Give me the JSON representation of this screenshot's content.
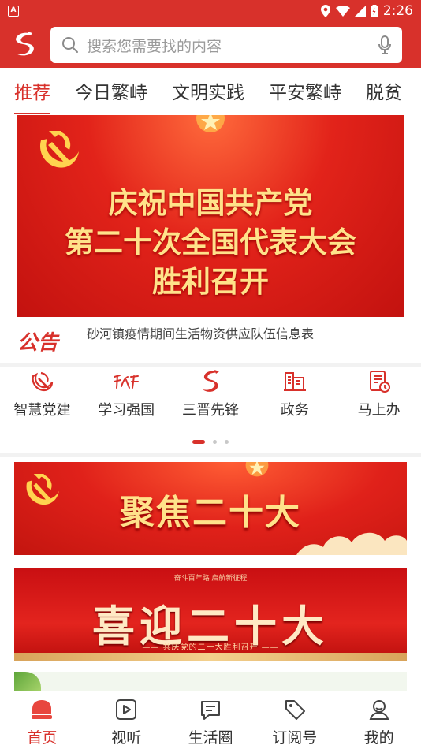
{
  "status_bar": {
    "time": "2:26",
    "app_badge": "A"
  },
  "search": {
    "placeholder": "搜索您需要找的内容"
  },
  "tabs": [
    {
      "label": "推荐",
      "active": true
    },
    {
      "label": "今日繁峙"
    },
    {
      "label": "文明实践"
    },
    {
      "label": "平安繁峙"
    },
    {
      "label": "脱贫"
    }
  ],
  "banner": {
    "line1": "庆祝中国共产党",
    "line2": "第二十次全国代表大会",
    "line3": "胜利召开"
  },
  "notice": {
    "logo_text": "公告",
    "text": "砂河镇疫情期间生活物资供应队伍信息表"
  },
  "quick_links": [
    {
      "label": "智慧党建",
      "icon": "party-flag-icon"
    },
    {
      "label": "学习强国",
      "icon": "xuexi-icon"
    },
    {
      "label": "三晋先锋",
      "icon": "sanjin-icon"
    },
    {
      "label": "政务",
      "icon": "government-building-icon"
    },
    {
      "label": "马上办",
      "icon": "clock-document-icon"
    }
  ],
  "cards": [
    {
      "title": "聚焦二十大"
    },
    {
      "top": "奋斗百年路 启航新征程",
      "title": "喜迎二十大",
      "sub": "—— 共庆党的二十大胜利召开 ——"
    }
  ],
  "bottom_nav": [
    {
      "label": "首页",
      "icon": "home-icon",
      "active": true
    },
    {
      "label": "视听",
      "icon": "play-icon"
    },
    {
      "label": "生活圈",
      "icon": "chat-icon"
    },
    {
      "label": "订阅号",
      "icon": "tag-icon"
    },
    {
      "label": "我的",
      "icon": "user-icon"
    }
  ],
  "colors": {
    "brand": "#d8312b",
    "text": "#333333",
    "muted": "#9a9a9a"
  }
}
